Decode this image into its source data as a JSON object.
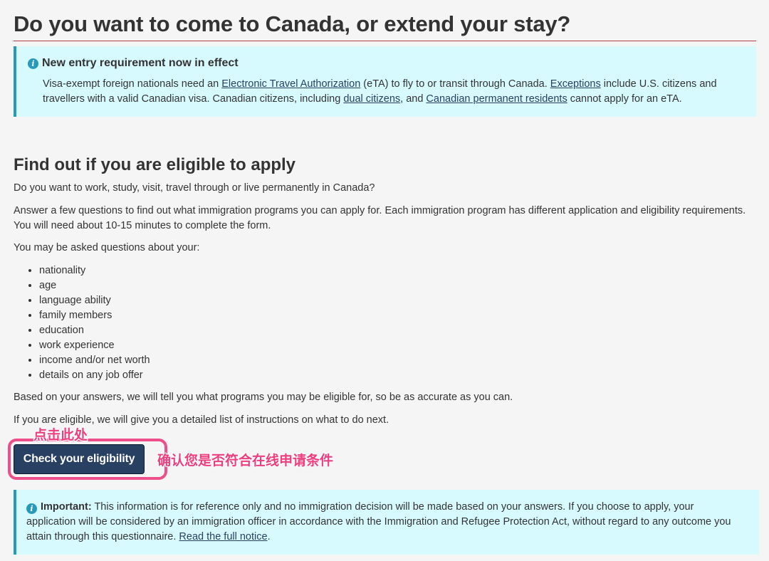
{
  "heading": "Do you want to come to Canada, or extend your stay?",
  "notice": {
    "title": "New entry requirement now in effect",
    "text1": "Visa-exempt foreign nationals need an ",
    "link_eta": "Electronic Travel Authorization",
    "text2": " (eTA) to fly to or transit through Canada. ",
    "link_exceptions": "Exceptions",
    "text3": " include U.S. citizens and travellers with a valid Canadian visa. Canadian citizens, including ",
    "link_dual": "dual citizens",
    "text4": ", and ",
    "link_pr": "Canadian permanent residents",
    "text5": " cannot apply for an eTA."
  },
  "section": {
    "title": "Find out if you are eligible to apply",
    "p1": "Do you want to work, study, visit, travel through or live permanently in Canada?",
    "p2": "Answer a few questions to find out what immigration programs you can apply for. Each immigration program has different application and eligibility requirements. You will need about 10-15 minutes to complete the form.",
    "p3": "You may be asked questions about your:",
    "items": [
      "nationality",
      "age",
      "language ability",
      "family members",
      "education",
      "work experience",
      "income and/or net worth",
      "details on any job offer"
    ],
    "p4": "Based on your answers, we will tell you what programs you may be eligible for, so be as accurate as you can.",
    "p5": "If you are eligible, we will give you a detailed list of instructions on what to do next."
  },
  "cta_label": "Check your eligibility",
  "annotations": {
    "click_here": "点击此处",
    "confirm": "确认您是否符合在线申请条件"
  },
  "important": {
    "label": "Important:",
    "text": " This information is for reference only and no immigration decision will be made based on your answers. If you choose to apply, your application will be considered by an immigration officer in accordance with the Immigration and Refugee Protection Act, without regard to any outcome you attain through this questionnaire. ",
    "link": "Read the full notice",
    "end": "."
  },
  "colors": {
    "alert_bg": "#d7faff",
    "alert_border": "#269abc",
    "button_bg": "#284162",
    "annotation": "#ee3e7e",
    "heading_rule": "#af3c43"
  }
}
